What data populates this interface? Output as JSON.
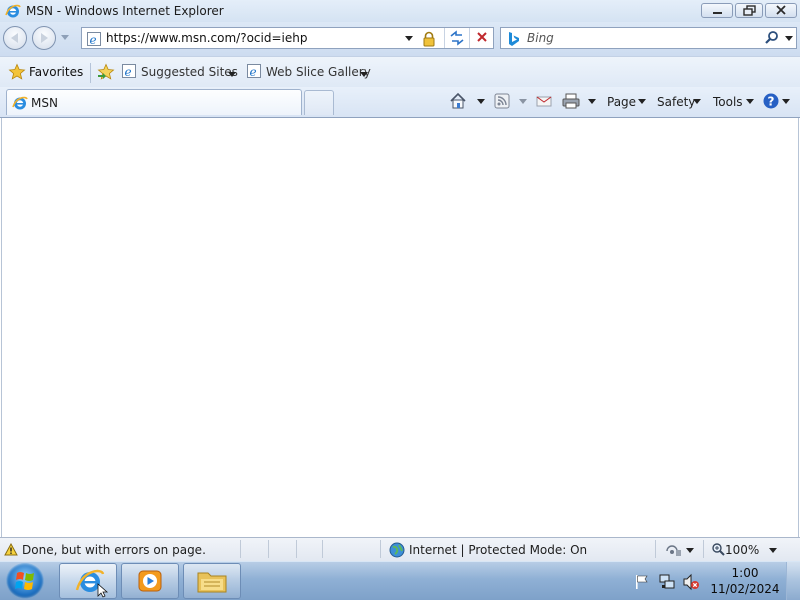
{
  "window": {
    "title": "MSN - Windows Internet Explorer"
  },
  "address_bar": {
    "url": "https://www.msn.com/?ocid=iehp"
  },
  "search": {
    "placeholder": "Bing"
  },
  "favorites_bar": {
    "favorites_label": "Favorites",
    "items": [
      {
        "label": "Suggested Sites"
      },
      {
        "label": "Web Slice Gallery"
      }
    ]
  },
  "tabs": [
    {
      "label": "MSN",
      "active": true
    }
  ],
  "command_bar": {
    "page_label": "Page",
    "safety_label": "Safety",
    "tools_label": "Tools"
  },
  "status_bar": {
    "text": "Done, but with errors on page.",
    "zone": "Internet | Protected Mode: On",
    "zoom": "100%"
  },
  "taskbar": {
    "clock_time": "1:00",
    "clock_date": "11/02/2024"
  },
  "icons": {
    "title": "ie-icon",
    "lock": "lock-icon",
    "status": "warning-icon",
    "zone": "globe-icon"
  },
  "colors": {
    "chrome": "#d5e3f3",
    "accent": "#1e6fc8",
    "stop_red": "#c0282d"
  }
}
